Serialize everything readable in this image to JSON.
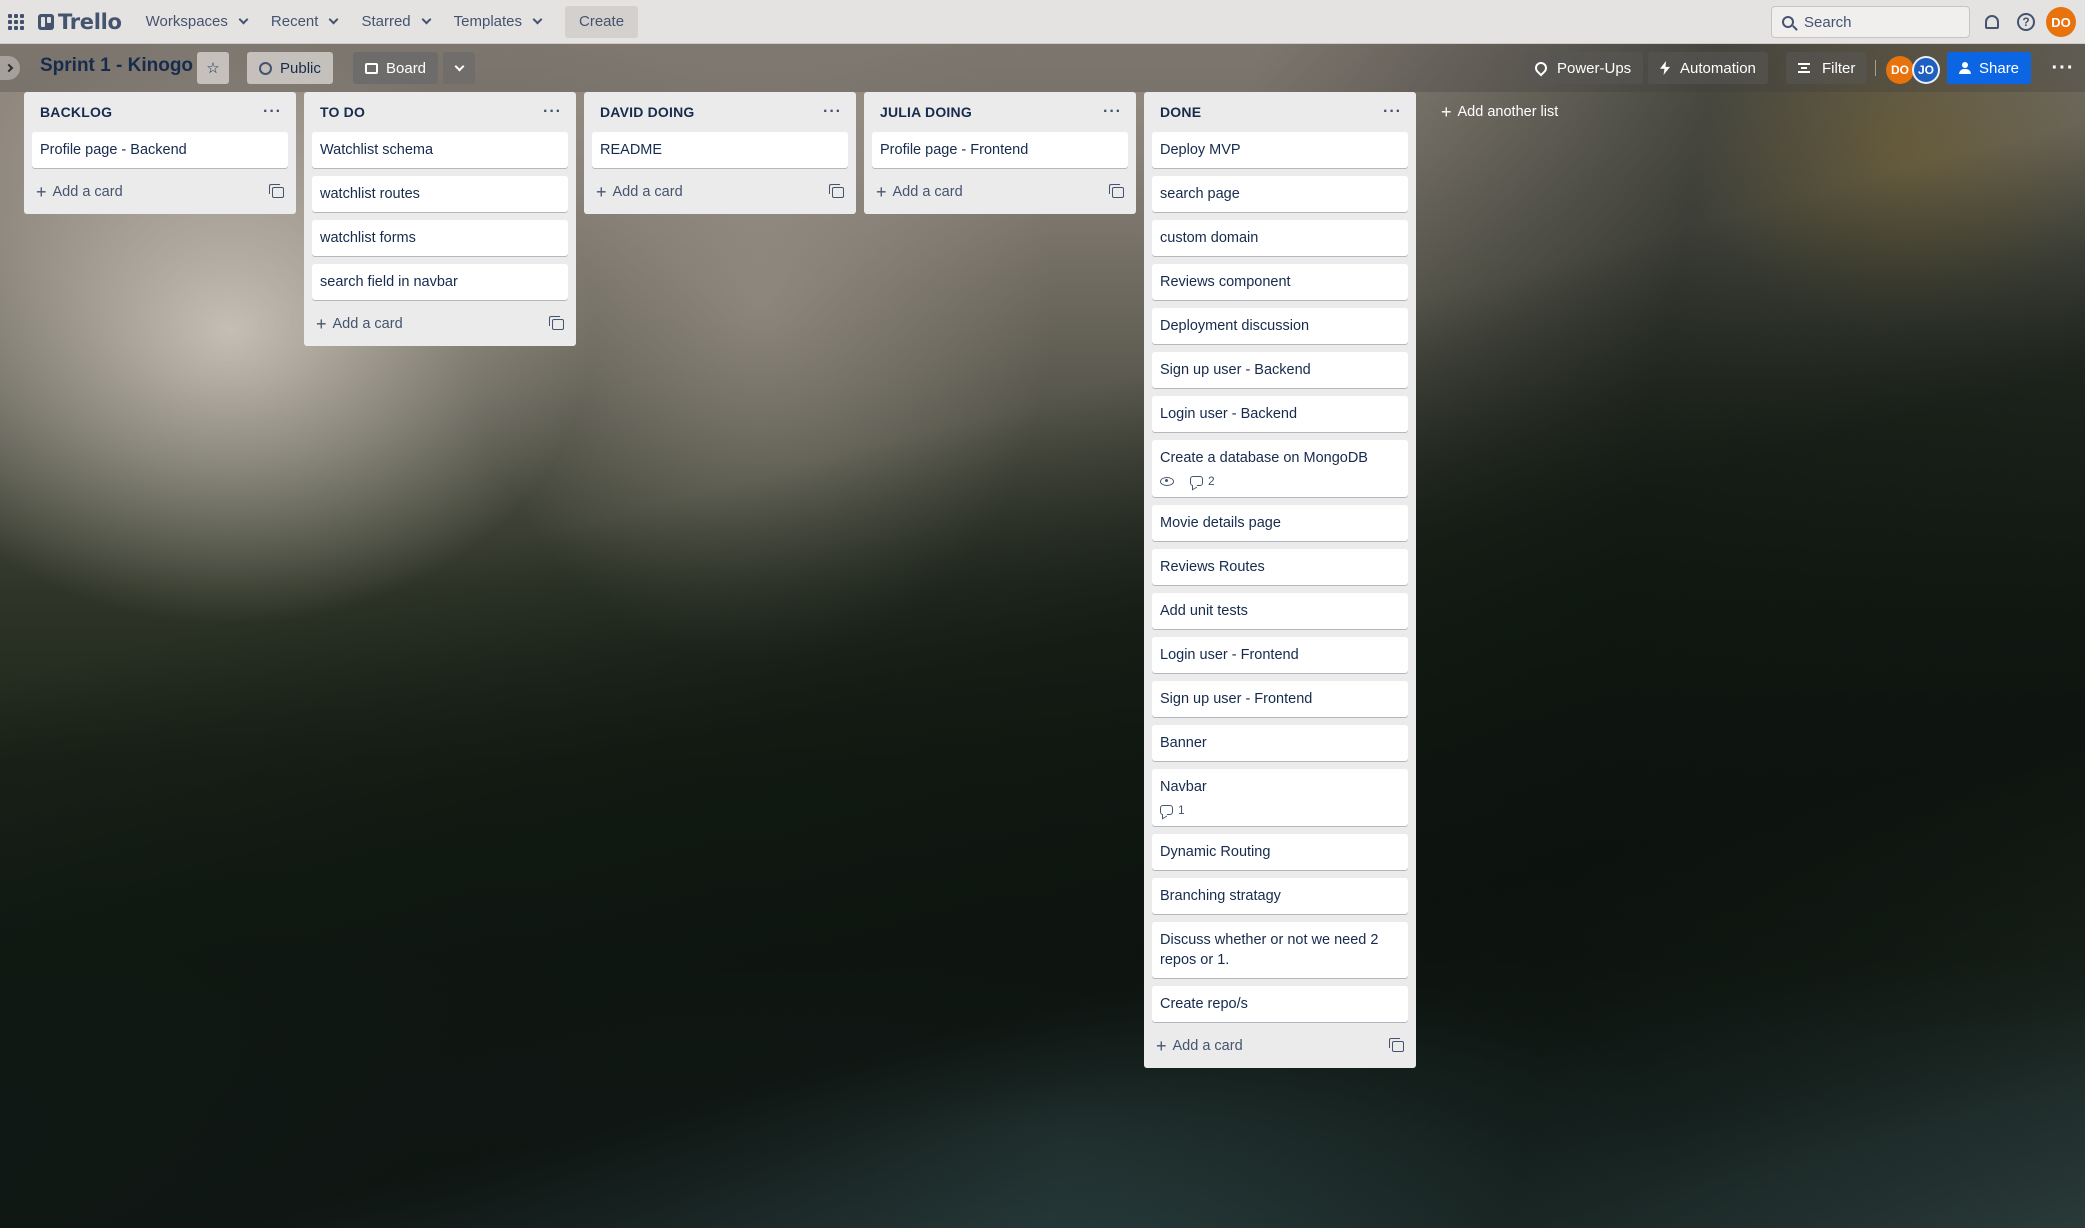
{
  "nav": {
    "logo_text": "Trello",
    "menu": [
      {
        "label": "Workspaces"
      },
      {
        "label": "Recent"
      },
      {
        "label": "Starred"
      },
      {
        "label": "Templates"
      }
    ],
    "create_label": "Create",
    "search_placeholder": "Search",
    "user_initials": "DO"
  },
  "board": {
    "title": "Sprint 1 - Kinogo",
    "visibility_label": "Public",
    "view_label": "Board",
    "powerups_label": "Power-Ups",
    "automation_label": "Automation",
    "filter_label": "Filter",
    "members": [
      "DO",
      "JO"
    ],
    "share_label": "Share",
    "add_list_label": "Add another list",
    "add_card_label": "Add a card"
  },
  "lists": [
    {
      "title": "BACKLOG",
      "cards": [
        {
          "title": "Profile page - Backend"
        }
      ]
    },
    {
      "title": "TO DO",
      "cards": [
        {
          "title": "Watchlist schema"
        },
        {
          "title": "watchlist routes"
        },
        {
          "title": "watchlist forms"
        },
        {
          "title": "search field in navbar"
        }
      ]
    },
    {
      "title": "DAVID DOING",
      "cards": [
        {
          "title": "README"
        }
      ]
    },
    {
      "title": "JULIA DOING",
      "cards": [
        {
          "title": "Profile page - Frontend"
        }
      ]
    },
    {
      "title": "DONE",
      "cards": [
        {
          "title": "Deploy MVP"
        },
        {
          "title": "search page"
        },
        {
          "title": "custom domain"
        },
        {
          "title": "Reviews component"
        },
        {
          "title": "Deployment discussion"
        },
        {
          "title": "Sign up user - Backend"
        },
        {
          "title": "Login user - Backend"
        },
        {
          "title": "Create a database on MongoDB",
          "watching": true,
          "comments": "2"
        },
        {
          "title": "Movie details page"
        },
        {
          "title": "Reviews Routes"
        },
        {
          "title": "Add unit tests"
        },
        {
          "title": "Login user - Frontend"
        },
        {
          "title": "Sign up user - Frontend"
        },
        {
          "title": "Banner"
        },
        {
          "title": "Navbar",
          "comments": "1"
        },
        {
          "title": "Dynamic Routing"
        },
        {
          "title": "Branching stratagy"
        },
        {
          "title": "Discuss whether or not we need 2 repos or 1."
        },
        {
          "title": "Create repo/s"
        }
      ]
    }
  ]
}
